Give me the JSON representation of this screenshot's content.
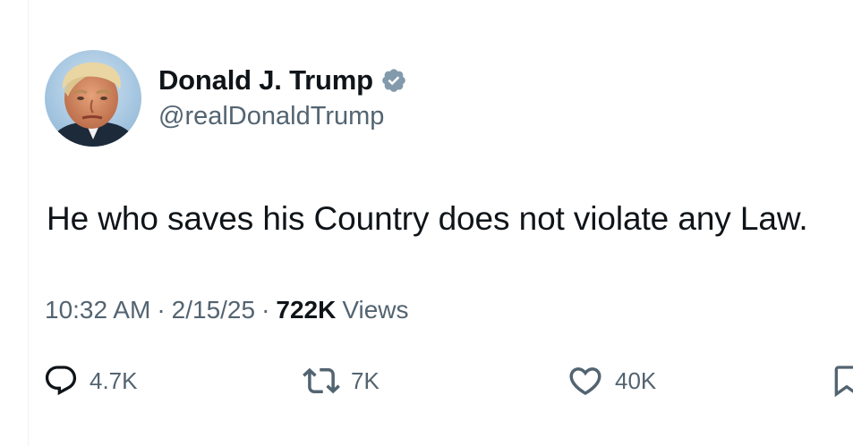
{
  "tweet": {
    "author": {
      "display_name": "Donald J. Trump",
      "handle": "@realDonaldTrump",
      "verified": true,
      "verified_color": "#829aab"
    },
    "text": "He who saves his Country does not violate any Law.",
    "meta": {
      "time": "10:32 AM",
      "separator": "·",
      "date": "2/15/25",
      "views_count": "722K",
      "views_label": "Views"
    },
    "actions": {
      "reply": {
        "icon": "reply-icon",
        "count": "4.7K"
      },
      "retweet": {
        "icon": "retweet-icon",
        "count": "7K"
      },
      "like": {
        "icon": "heart-icon",
        "count": "40K"
      },
      "bookmark": {
        "icon": "bookmark-icon"
      }
    }
  },
  "colors": {
    "text_primary": "#0f1419",
    "text_secondary": "#536471",
    "background": "#ffffff"
  }
}
